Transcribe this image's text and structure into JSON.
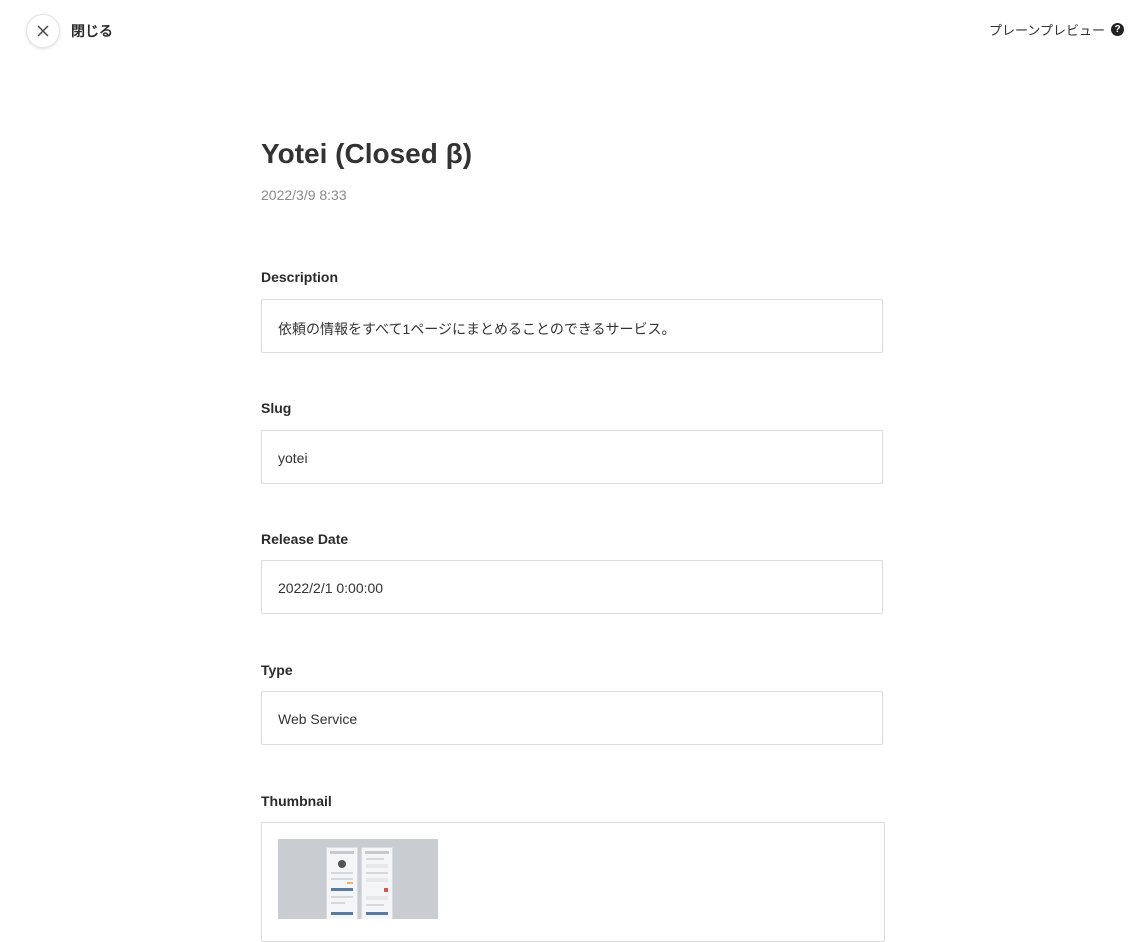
{
  "header": {
    "close_label": "閉じる",
    "preview_label": "プレーンプレビュー",
    "help_icon": "?"
  },
  "page": {
    "title": "Yotei (Closed β)",
    "date": "2022/3/9 8:33"
  },
  "fields": {
    "description": {
      "label": "Description",
      "value": "依頼の情報をすべて1ページにまとめることのできるサービス。"
    },
    "slug": {
      "label": "Slug",
      "value": "yotei"
    },
    "release_date": {
      "label": "Release Date",
      "value": "2022/2/1 0:00:00"
    },
    "type": {
      "label": "Type",
      "value": "Web Service"
    },
    "thumbnail": {
      "label": "Thumbnail"
    }
  }
}
